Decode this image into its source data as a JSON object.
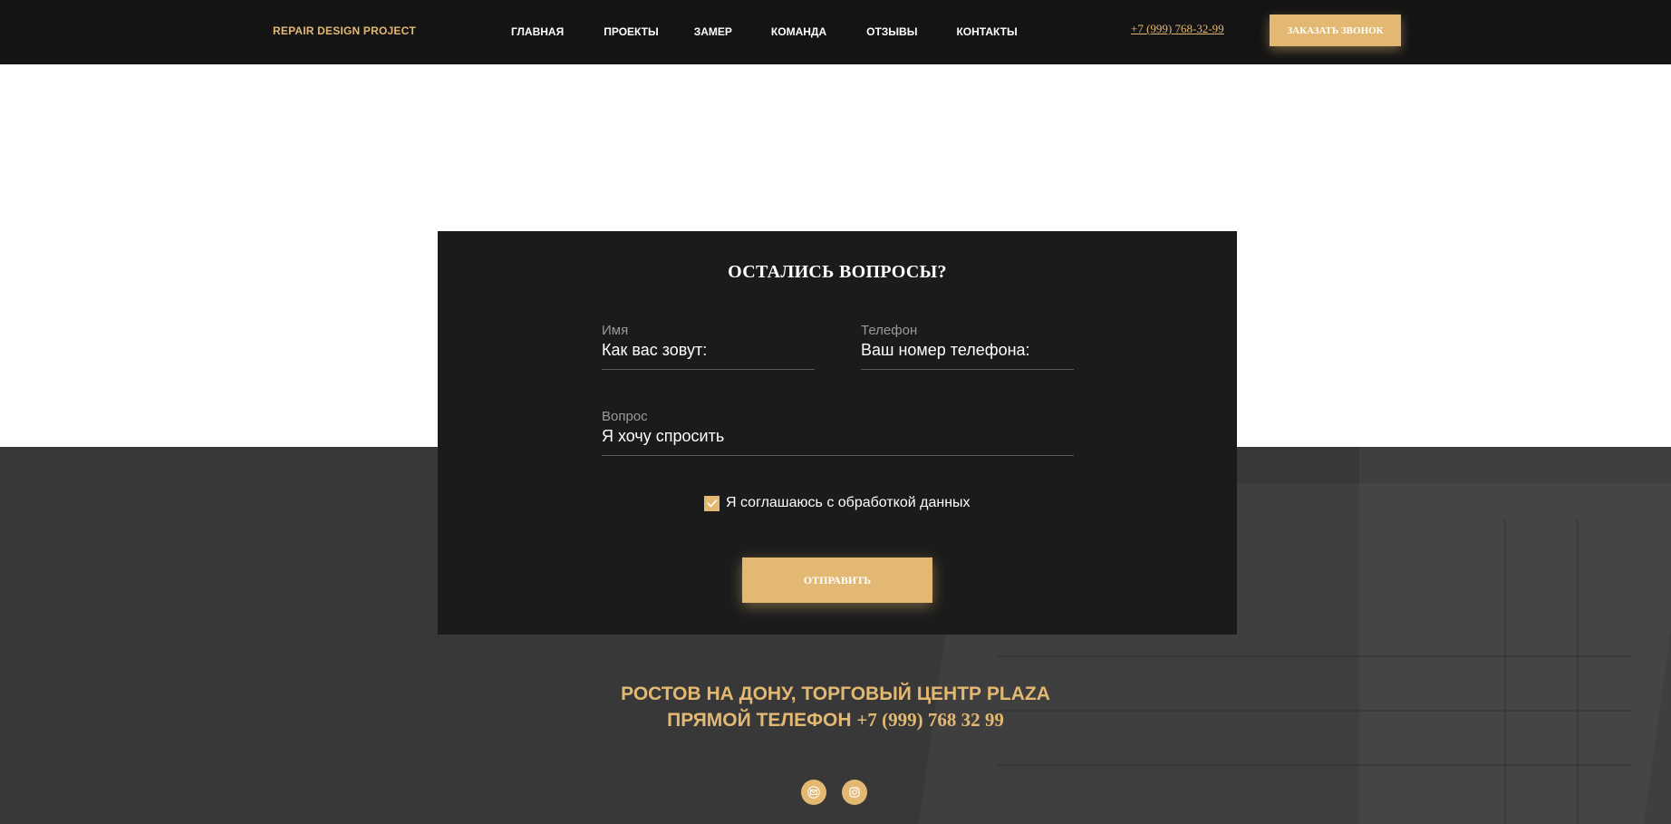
{
  "header": {
    "logo": "REPAIR DESIGN PROJECT",
    "nav": [
      "ГЛАВНАЯ",
      "ПРОЕКТЫ",
      "ЗАМЕР",
      "КОМАНДА",
      "ОТЗЫВЫ",
      "КОНТАКТЫ"
    ],
    "phone": "+7 (999) 768-32-99",
    "call_button": "ЗАКАЗАТЬ ЗВОНОК"
  },
  "form": {
    "title": "ОСТАЛИСЬ ВОПРОСЫ?",
    "name": {
      "label": "Имя",
      "placeholder": "Как вас зовут:"
    },
    "phone": {
      "label": "Телефон",
      "placeholder": "Ваш номер телефона:"
    },
    "question": {
      "label": "Вопрос",
      "placeholder": "Я хочу спросить"
    },
    "consent": {
      "label": "Я соглашаюсь с обработкой данных",
      "checked": true
    },
    "submit": "ОТПРАВИТЬ"
  },
  "footer": {
    "address_text": "РОСТОВ НА ДОНУ, ТОРГОВЫЙ ЦЕНТР PLAZA",
    "phone_label": "ПРЯМОЙ ТЕЛЕФОН",
    "phone_number": "+7 (999) 768 32 99",
    "socials": [
      "mail-icon",
      "instagram-icon"
    ]
  },
  "colors": {
    "accent": "#e3b873",
    "header_bg": "#141414",
    "card_bg": "#1b1b1b",
    "section_bg": "#383838"
  }
}
